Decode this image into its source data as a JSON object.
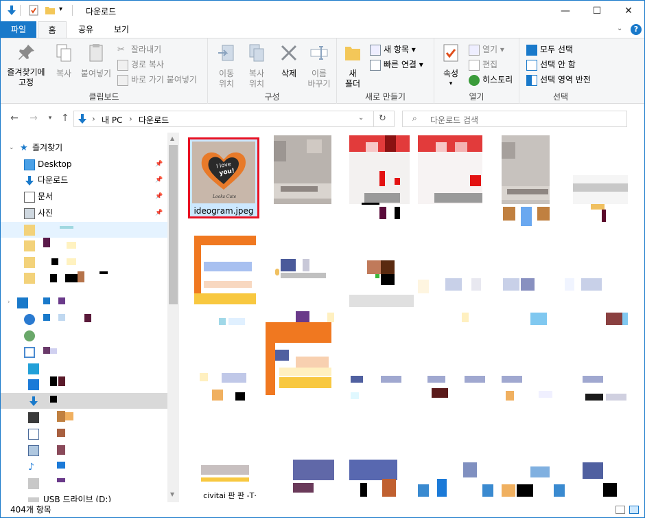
{
  "window": {
    "title": "다운로드",
    "minimize_glyph": "—",
    "maximize_glyph": "☐",
    "close_glyph": "✕"
  },
  "tabs": [
    {
      "label": "파일",
      "active": false
    },
    {
      "label": "홈",
      "active": true
    },
    {
      "label": "공유",
      "active": false
    },
    {
      "label": "보기",
      "active": false
    }
  ],
  "ribbon": {
    "clipboard": {
      "label": "클립보드",
      "pin_label": "즐겨찾기에\n고정",
      "copy_label": "복사",
      "paste_label": "붙여넣기",
      "cut_label": "잘라내기",
      "copy_path_label": "경로 복사",
      "paste_shortcut_label": "바로 가기 붙여넣기"
    },
    "organize": {
      "label": "구성",
      "move_label": "이동\n위치",
      "copyto_label": "복사\n위치",
      "delete_label": "삭제",
      "rename_label": "이름\n바꾸기"
    },
    "new": {
      "label": "새로 만들기",
      "newfolder_label": "새\n폴더",
      "newitem_label": "새 항목",
      "easyaccess_label": "빠른 연결"
    },
    "open": {
      "label": "열기",
      "properties_label": "속성",
      "open_label": "열기",
      "edit_label": "편집",
      "history_label": "히스토리"
    },
    "select": {
      "label": "선택",
      "selectall_label": "모두 선택",
      "selectnone_label": "선택 안 함",
      "invert_label": "선택 영역 반전"
    }
  },
  "address": {
    "crumbs": [
      "내 PC",
      "다운로드"
    ],
    "search_placeholder": "다운로드 검색"
  },
  "nav": {
    "quick_access": "즐겨찾기",
    "items": [
      {
        "label": "Desktop",
        "icon": "desktop-icon",
        "pinned": true
      },
      {
        "label": "다운로드",
        "icon": "download-icon",
        "pinned": true
      },
      {
        "label": "문서",
        "icon": "document-icon",
        "pinned": true
      },
      {
        "label": "사진",
        "icon": "picture-icon",
        "pinned": true
      }
    ],
    "usb_label": "USB 드라이브 (D:)"
  },
  "files": [
    {
      "name": "ideogram.jpeg",
      "selected": true,
      "highlighted": true
    },
    {
      "name": "civitai 판 판 -T·",
      "selected": false,
      "highlighted": false
    }
  ],
  "thumbnail_text": {
    "logo_line1": "I love",
    "logo_line2": "you!",
    "caption": "Looks Cute"
  },
  "status": {
    "count_label": "404개 항목"
  },
  "colors": {
    "accent": "#1979ca",
    "highlight_border": "#e81123",
    "selection_bg": "#cce8ff"
  }
}
